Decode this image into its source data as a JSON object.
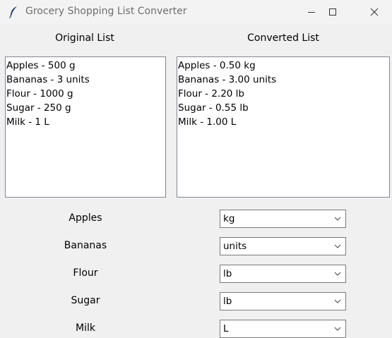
{
  "window": {
    "title": "Grocery Shopping List Converter",
    "buttons": [
      "minimize-icon",
      "maximize-icon",
      "close-icon"
    ]
  },
  "headers": {
    "original": "Original List",
    "converted": "Converted List"
  },
  "original_list": [
    "Apples - 500 g",
    "Bananas - 3 units",
    "Flour - 1000 g",
    "Sugar - 250 g",
    "Milk - 1 L"
  ],
  "converted_list": [
    "Apples - 0.50 kg",
    "Bananas - 3.00 units",
    "Flour - 2.20 lb",
    "Sugar - 0.55 lb",
    "Milk - 1.00 L"
  ],
  "unit_rows": [
    {
      "label": "Apples",
      "selected": "kg"
    },
    {
      "label": "Bananas",
      "selected": "units"
    },
    {
      "label": "Flour",
      "selected": "lb"
    },
    {
      "label": "Sugar",
      "selected": "lb"
    },
    {
      "label": "Milk",
      "selected": "L"
    }
  ],
  "colors": {
    "window_bg": "#f0f0f0",
    "list_bg": "#ffffff",
    "border": "#828790"
  }
}
